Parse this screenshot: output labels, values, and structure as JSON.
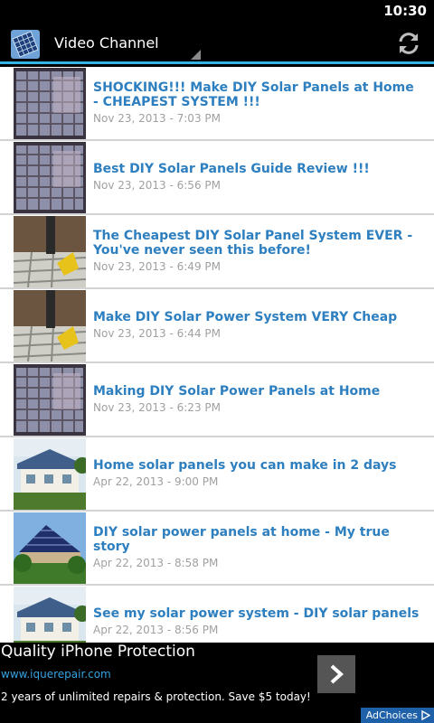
{
  "status_bar": {
    "time": "10:30"
  },
  "action_bar": {
    "title": "Video Channel",
    "app_icon": "solar-panel-icon",
    "refresh_icon": "refresh-icon",
    "accent_color": "#33b5e5"
  },
  "videos": [
    {
      "title": "SHOCKING!!! Make DIY Solar Panels at Home - CHEAPEST SYSTEM !!!",
      "date": "Nov 23, 2013 - 7:03 PM",
      "thumb": "solar-cells"
    },
    {
      "title": "Best DIY Solar Panels Guide Review !!!",
      "date": "Nov 23, 2013 - 6:56 PM",
      "thumb": "solar-cells"
    },
    {
      "title": "The Cheapest DIY Solar Panel System EVER - You've never seen this before!",
      "date": "Nov 23, 2013 - 6:49 PM",
      "thumb": "soldering"
    },
    {
      "title": "Make DIY Solar Power System VERY Cheap",
      "date": "Nov 23, 2013 - 6:44 PM",
      "thumb": "soldering"
    },
    {
      "title": "Making DIY Solar Power Panels at Home",
      "date": "Nov 23, 2013 - 6:23 PM",
      "thumb": "solar-cells"
    },
    {
      "title": "Home solar panels you can make in 2 days",
      "date": "Apr 22, 2013 - 9:00 PM",
      "thumb": "house"
    },
    {
      "title": "DIY solar power panels at home - My true story",
      "date": "Apr 22, 2013 - 8:58 PM",
      "thumb": "roof"
    },
    {
      "title": "See my solar power system - DIY solar panels",
      "date": "Apr 22, 2013 - 8:56 PM",
      "thumb": "house"
    }
  ],
  "ad": {
    "title": "Quality iPhone Protection",
    "url": "www.iquerepair.com",
    "description": "2 years of unlimited repairs & protection. Save $5 today!",
    "adchoices_label": "AdChoices",
    "arrow_icon": "chevron-right-icon"
  }
}
